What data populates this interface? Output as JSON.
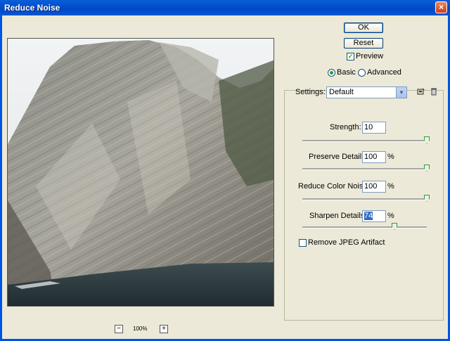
{
  "window": {
    "title": "Reduce Noise",
    "close_glyph": "×"
  },
  "buttons": {
    "ok": "OK",
    "reset": "Reset"
  },
  "preview_toggle": {
    "label": "Preview",
    "checked": true
  },
  "mode": {
    "basic": "Basic",
    "advanced": "Advanced",
    "selected": "Basic"
  },
  "settings": {
    "label": "Settings:",
    "value": "Default",
    "save_icon": "save-settings-icon",
    "delete_icon": "trash-icon"
  },
  "controls": {
    "strength": {
      "label": "Strength:",
      "value": "10",
      "unit": "",
      "level": 1.0
    },
    "preserve_details": {
      "label": "Preserve Details:",
      "value": "100",
      "unit": "%",
      "level": 1.0
    },
    "reduce_color_noise": {
      "label": "Reduce Color Noise:",
      "value": "100",
      "unit": "%",
      "level": 1.0
    },
    "sharpen_details": {
      "label": "Sharpen Details:",
      "value": "74",
      "unit": "%",
      "level": 0.74
    }
  },
  "jpeg": {
    "label": "Remove JPEG Artifact",
    "checked": false
  },
  "zoom": {
    "level": "100%",
    "minus": "−",
    "plus": "+"
  },
  "colors": {
    "titlebar": "#0054e3",
    "dialog": "#ece9d8",
    "check": "#21a121"
  }
}
